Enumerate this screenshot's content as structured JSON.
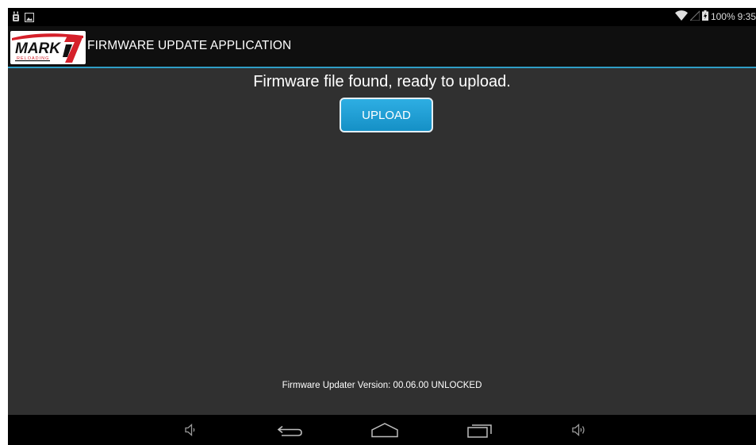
{
  "status_bar": {
    "left_icons": [
      "usb-debug-icon",
      "image-notification-icon"
    ],
    "right_icons": [
      "wifi-icon",
      "signal-icon",
      "battery-charging-icon"
    ],
    "battery_text": "100%",
    "clock": "9:35"
  },
  "action_bar": {
    "logo": {
      "brand_text": "MARK",
      "brand_number": "7",
      "sub_text": "RELOADING",
      "colors": {
        "black": "#111111",
        "red": "#d5202a"
      }
    },
    "title": "FIRMWARE UPDATE APPLICATION",
    "accent_color": "#2f9ec6"
  },
  "main": {
    "status_message": "Firmware file found, ready to upload.",
    "upload_button": {
      "label": "UPLOAD",
      "color": "#1fa0d8"
    },
    "version_text": "Firmware Updater Version: 00.06.00 UNLOCKED"
  },
  "nav_bar": {
    "buttons": [
      "volume-down-icon",
      "back-icon",
      "home-icon",
      "recent-apps-icon",
      "volume-up-icon"
    ]
  }
}
